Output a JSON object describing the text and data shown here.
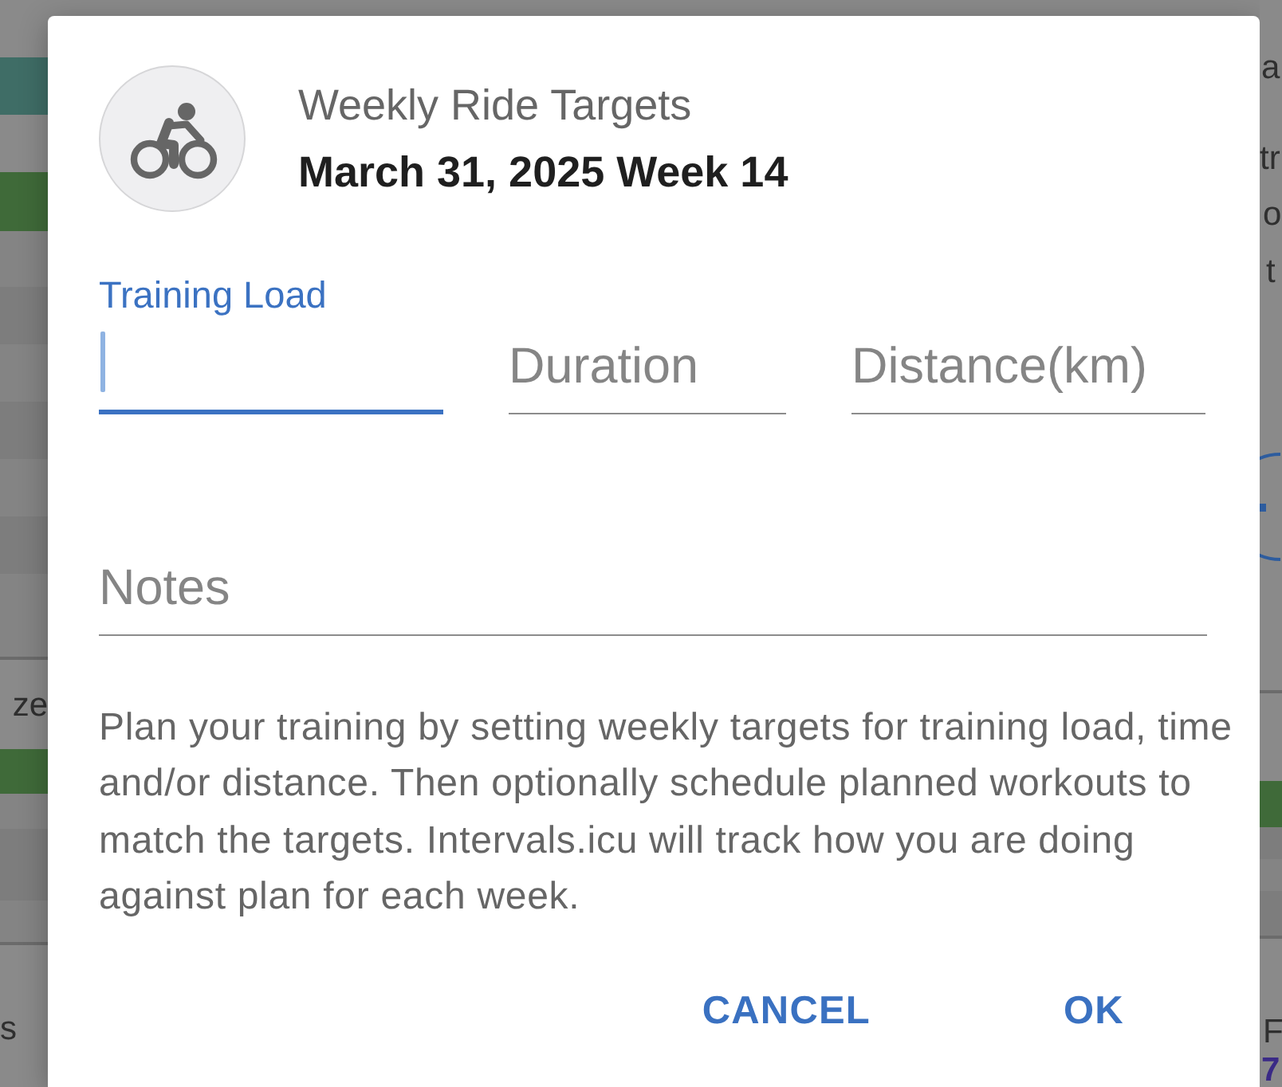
{
  "background": {
    "left_texts": [
      "ze",
      "s"
    ],
    "right_texts": [
      "a",
      "tr",
      "o",
      "t",
      "F",
      "7"
    ]
  },
  "dialog": {
    "title": "Weekly Ride Targets",
    "subtitle": "March 31, 2025 Week 14",
    "fields": [
      {
        "placeholder": "Training Load",
        "focused": true
      },
      {
        "placeholder": "Duration",
        "focused": false
      },
      {
        "placeholder": "Distance(km)",
        "focused": false
      }
    ],
    "notes": {
      "placeholder": "Notes",
      "focused": false
    },
    "description": "Plan your training by setting weekly targets for training load, time and/or distance. Then optionally schedule planned workouts to match the targets. Intervals.icu will track how you are doing against plan for each week.",
    "buttons": [
      "CANCEL",
      "OK"
    ]
  }
}
